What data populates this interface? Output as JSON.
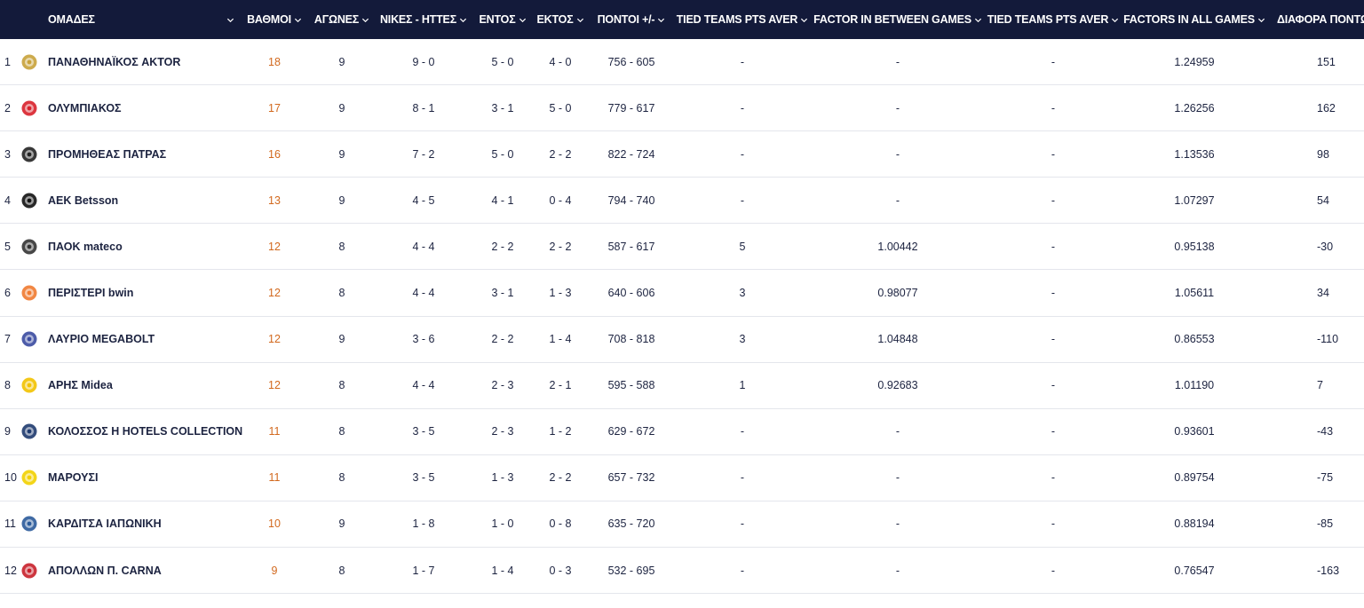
{
  "columns": {
    "team": "ΟΜΑΔΕΣ",
    "points": "ΒΑΘΜΟΙ",
    "games": "ΑΓΩΝΕΣ",
    "wins_losses": "ΝΙΚΕΣ - ΗΤΤΕΣ",
    "home": "ΕΝΤΟΣ",
    "away": "ΕΚΤΟΣ",
    "points_for_against": "ΠΟΝΤΟΙ +/-",
    "tied_teams_pts_aver": "TIED TEAMS PTS AVER",
    "factor_between_games": "FACTOR IN BETWEEN GAMES",
    "tied_teams_pts_aver_2": "TIED TEAMS PTS AVER",
    "factors_all_games": "FACTORS IN ALL GAMES",
    "points_difference": "ΔΙΑΦΟΡΑ ΠΟΝΤΩΝ"
  },
  "teams": [
    {
      "pos": "1",
      "name": "ΠΑΝΑΘΗΝΑΪΚΟΣ AKTOR",
      "points": "18",
      "games": "9",
      "wl": "9 - 0",
      "home": "5 - 0",
      "away": "4 - 0",
      "pf": "756 - 605",
      "ttpa": "-",
      "fbg": "-",
      "ttpa2": "-",
      "fag": "1.24959",
      "diff": "151",
      "logo": "panathinaikos-logo",
      "logo_color": "#c8a23a"
    },
    {
      "pos": "2",
      "name": "ΟΛΥΜΠΙΑΚΟΣ",
      "points": "17",
      "games": "9",
      "wl": "8 - 1",
      "home": "3 - 1",
      "away": "5 - 0",
      "pf": "779 - 617",
      "ttpa": "-",
      "fbg": "-",
      "ttpa2": "-",
      "fag": "1.26256",
      "diff": "162",
      "logo": "olympiacos-logo",
      "logo_color": "#d8202a"
    },
    {
      "pos": "3",
      "name": "ΠΡΟΜΗΘΕΑΣ ΠΑΤΡΑΣ",
      "points": "16",
      "games": "9",
      "wl": "7 - 2",
      "home": "5 - 0",
      "away": "2 - 2",
      "pf": "822 - 724",
      "ttpa": "-",
      "fbg": "-",
      "ttpa2": "-",
      "fag": "1.13536",
      "diff": "98",
      "logo": "promitheas-logo",
      "logo_color": "#222222"
    },
    {
      "pos": "4",
      "name": "ΑΕΚ Betsson",
      "points": "13",
      "games": "9",
      "wl": "4 - 5",
      "home": "4 - 1",
      "away": "0 - 4",
      "pf": "794 - 740",
      "ttpa": "-",
      "fbg": "-",
      "ttpa2": "-",
      "fag": "1.07297",
      "diff": "54",
      "logo": "aek-logo",
      "logo_color": "#111111"
    },
    {
      "pos": "5",
      "name": "ΠΑΟΚ mateco",
      "points": "12",
      "games": "8",
      "wl": "4 - 4",
      "home": "2 - 2",
      "away": "2 - 2",
      "pf": "587 - 617",
      "ttpa": "5",
      "fbg": "1.00442",
      "ttpa2": "-",
      "fag": "0.95138",
      "diff": "-30",
      "logo": "paok-logo",
      "logo_color": "#333333"
    },
    {
      "pos": "6",
      "name": "ΠΕΡΙΣΤΕΡΙ bwin",
      "points": "12",
      "games": "8",
      "wl": "4 - 4",
      "home": "3 - 1",
      "away": "1 - 3",
      "pf": "640 - 606",
      "ttpa": "3",
      "fbg": "0.98077",
      "ttpa2": "-",
      "fag": "1.05611",
      "diff": "34",
      "logo": "peristeri-logo",
      "logo_color": "#f07a30"
    },
    {
      "pos": "7",
      "name": "ΛΑΥΡΙΟ MEGABOLT",
      "points": "12",
      "games": "9",
      "wl": "3 - 6",
      "home": "2 - 2",
      "away": "1 - 4",
      "pf": "708 - 818",
      "ttpa": "3",
      "fbg": "1.04848",
      "ttpa2": "-",
      "fag": "0.86553",
      "diff": "-110",
      "logo": "lavrio-logo",
      "logo_color": "#3a4aa0"
    },
    {
      "pos": "8",
      "name": "ΑΡΗΣ Midea",
      "points": "12",
      "games": "8",
      "wl": "4 - 4",
      "home": "2 - 3",
      "away": "2 - 1",
      "pf": "595 - 588",
      "ttpa": "1",
      "fbg": "0.92683",
      "ttpa2": "-",
      "fag": "1.01190",
      "diff": "7",
      "logo": "aris-logo",
      "logo_color": "#f2c200"
    },
    {
      "pos": "9",
      "name": "ΚΟΛΟΣΣΟΣ H HOTELS COLLECTION",
      "points": "11",
      "games": "8",
      "wl": "3 - 5",
      "home": "2 - 3",
      "away": "1 - 2",
      "pf": "629 - 672",
      "ttpa": "-",
      "fbg": "-",
      "ttpa2": "-",
      "fag": "0.93601",
      "diff": "-43",
      "logo": "kolossos-logo",
      "logo_color": "#1e3a6e"
    },
    {
      "pos": "10",
      "name": "ΜΑΡΟΥΣΙ",
      "points": "11",
      "games": "8",
      "wl": "3 - 5",
      "home": "1 - 3",
      "away": "2 - 2",
      "pf": "657 - 732",
      "ttpa": "-",
      "fbg": "-",
      "ttpa2": "-",
      "fag": "0.89754",
      "diff": "-75",
      "logo": "maroussi-logo",
      "logo_color": "#f2d000"
    },
    {
      "pos": "11",
      "name": "ΚΑΡΔΙΤΣΑ ΙΑΠΩΝΙΚΗ",
      "points": "10",
      "games": "9",
      "wl": "1 - 8",
      "home": "1 - 0",
      "away": "0 - 8",
      "pf": "635 - 720",
      "ttpa": "-",
      "fbg": "-",
      "ttpa2": "-",
      "fag": "0.88194",
      "diff": "-85",
      "logo": "karditsa-logo",
      "logo_color": "#2a5a9a"
    },
    {
      "pos": "12",
      "name": "ΑΠΟΛΛΩΝ Π. CARNA",
      "points": "9",
      "games": "8",
      "wl": "1 - 7",
      "home": "1 - 4",
      "away": "0 - 3",
      "pf": "532 - 695",
      "ttpa": "-",
      "fbg": "-",
      "ttpa2": "-",
      "fag": "0.76547",
      "diff": "-163",
      "logo": "apollon-logo",
      "logo_color": "#c8202a"
    }
  ],
  "colors": {
    "header_bg": "#131a3a",
    "header_text": "#ffffff",
    "points_accent": "#d2691e",
    "row_border": "#e4e6ec"
  }
}
